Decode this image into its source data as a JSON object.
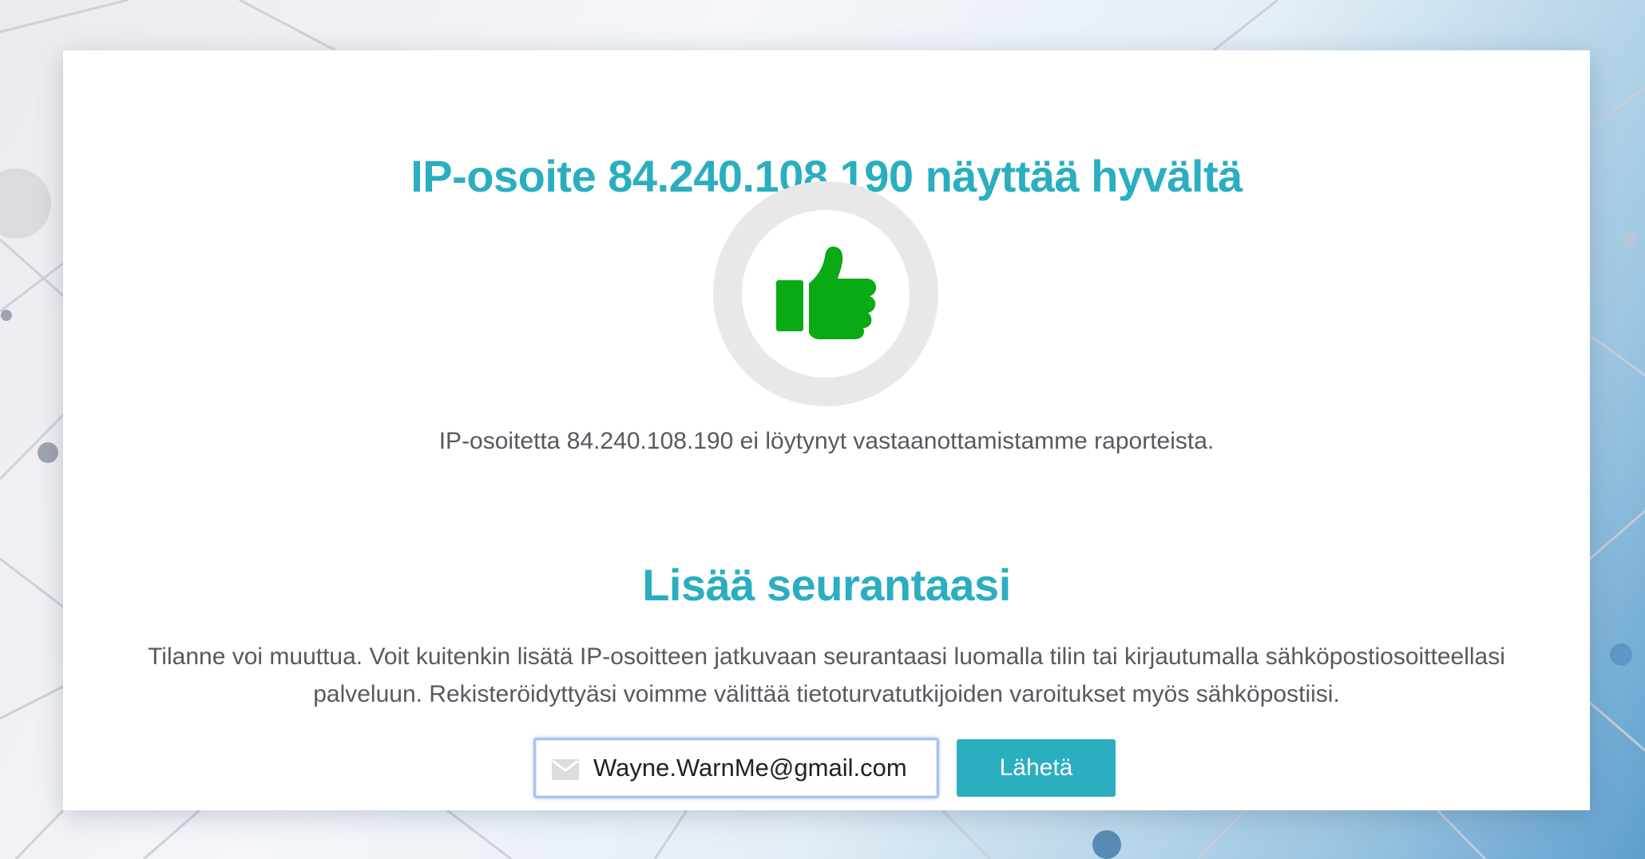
{
  "colors": {
    "accent": "#2aaec0",
    "thumb": "#0aaa14",
    "ring": "#e8e8e8",
    "text": "#555a5f"
  },
  "result": {
    "title": "IP-osoite 84.240.108.190 näyttää hyvältä",
    "status_icon": "thumbs-up-icon",
    "message": "IP-osoitetta 84.240.108.190 ei löytynyt vastaanottamistamme raporteista."
  },
  "monitor": {
    "title": "Lisää seurantaasi",
    "description": "Tilanne voi muuttua. Voit kuitenkin lisätä IP-osoitteen jatkuvaan seurantaasi luomalla tilin tai kirjautumalla sähköpostiosoitteellasi palveluun. Rekisteröidyttyäsi voimme välittää tietoturvatutkijoiden varoitukset myös sähköpostiisi.",
    "email_icon": "envelope-icon",
    "email_value": "Wayne.WarnMe@gmail.com",
    "submit_label": "Lähetä"
  }
}
